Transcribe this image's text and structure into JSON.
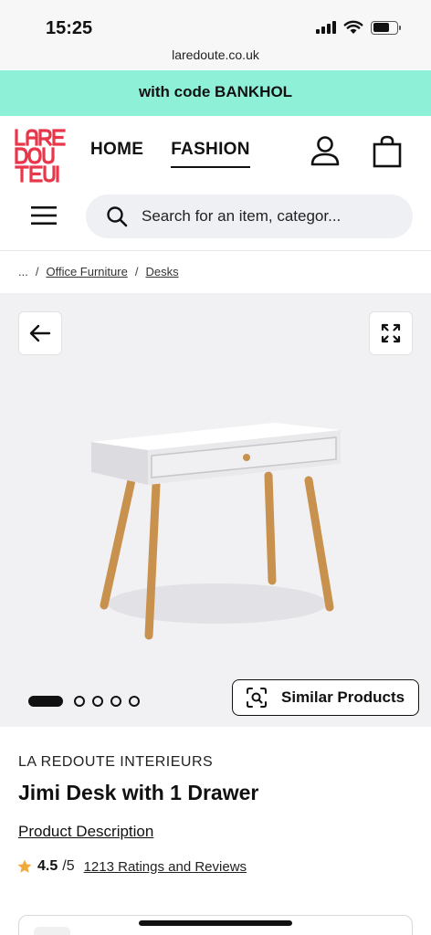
{
  "status_bar": {
    "time": "15:25",
    "url": "laredoute.co.uk",
    "battery_level": 0.7
  },
  "promo": {
    "text": "with code BANKHOL"
  },
  "header": {
    "logo_alt": "LA REDOUTE",
    "nav": [
      {
        "label": "HOME",
        "active": false
      },
      {
        "label": "FASHION",
        "active": true
      }
    ],
    "search_placeholder": "Search for an item, categor..."
  },
  "breadcrumb": {
    "ellipsis": "...",
    "separator": "/",
    "items": [
      "Office Furniture",
      "Desks"
    ]
  },
  "gallery": {
    "image_count": 5,
    "active_index": 0,
    "similar_label": "Similar Products"
  },
  "product": {
    "brand": "LA REDOUTE INTERIEURS",
    "title": "Jimi Desk with 1 Drawer",
    "description_link": "Product Description",
    "rating": "4.5",
    "rating_max": "/5",
    "ratings_link": "1213 Ratings and Reviews"
  },
  "icons": {
    "back": "arrow-left-icon",
    "expand": "expand-icon",
    "account": "account-icon",
    "bag": "shopping-bag-icon",
    "menu": "hamburger-menu-icon",
    "search": "search-icon",
    "similar": "visual-search-icon",
    "star": "star-icon"
  },
  "colors": {
    "promo_bg": "#8ef0d6",
    "logo_red": "#e8364b",
    "star": "#f0a93a"
  }
}
